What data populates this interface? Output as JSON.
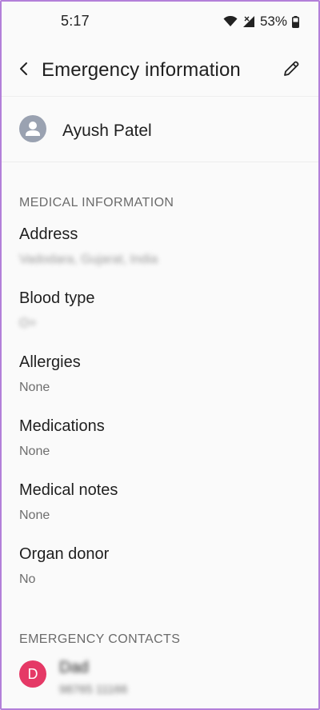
{
  "status_bar": {
    "time": "5:17",
    "battery": "53%"
  },
  "app_bar": {
    "title": "Emergency information"
  },
  "profile": {
    "name": "Ayush Patel"
  },
  "medical": {
    "header": "MEDICAL INFORMATION",
    "items": [
      {
        "label": "Address",
        "value": "Vadodara, Gujarat, India"
      },
      {
        "label": "Blood type",
        "value": "O+"
      },
      {
        "label": "Allergies",
        "value": "None"
      },
      {
        "label": "Medications",
        "value": "None"
      },
      {
        "label": "Medical notes",
        "value": "None"
      },
      {
        "label": "Organ donor",
        "value": "No"
      }
    ]
  },
  "contacts": {
    "header": "EMERGENCY CONTACTS",
    "items": [
      {
        "initial": "D",
        "name": "Dad",
        "phone": "98765 11166",
        "avatar_color": "#e53966"
      }
    ]
  },
  "colors": {
    "frame_border": "#b37fd9",
    "background": "#fafafa",
    "avatar_gray": "#9aa2b1"
  }
}
